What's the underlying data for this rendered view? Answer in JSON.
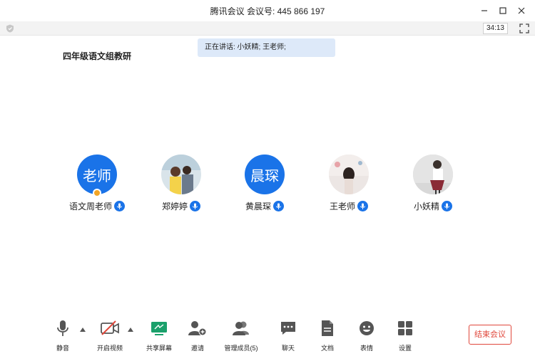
{
  "window": {
    "title": "腾讯会议  会议号: 445 866 197"
  },
  "infobar": {
    "timer": "34:13"
  },
  "meeting": {
    "title": "四年级语文组教研",
    "speaking": "正在讲话: 小妖精; 王老师;"
  },
  "participants": [
    {
      "name": "语文周老师",
      "avatar_text": "老师",
      "is_host": true
    },
    {
      "name": "郑婷婷",
      "avatar_text": "",
      "is_host": false
    },
    {
      "name": "黄晨琛",
      "avatar_text": "晨琛",
      "is_host": false
    },
    {
      "name": "王老师",
      "avatar_text": "",
      "is_host": false
    },
    {
      "name": "小妖精",
      "avatar_text": "",
      "is_host": false
    }
  ],
  "toolbar": {
    "mute": "静音",
    "video": "开启视频",
    "share": "共享屏幕",
    "invite": "邀请",
    "members": "管理成员(5)",
    "chat": "聊天",
    "docs": "文档",
    "emoji": "表情",
    "settings": "设置",
    "end": "结束会议"
  },
  "colors": {
    "accent": "#1a73e8",
    "danger": "#e0473b",
    "share_green": "#1aa06b",
    "speaking_bg": "#dde9f9"
  }
}
